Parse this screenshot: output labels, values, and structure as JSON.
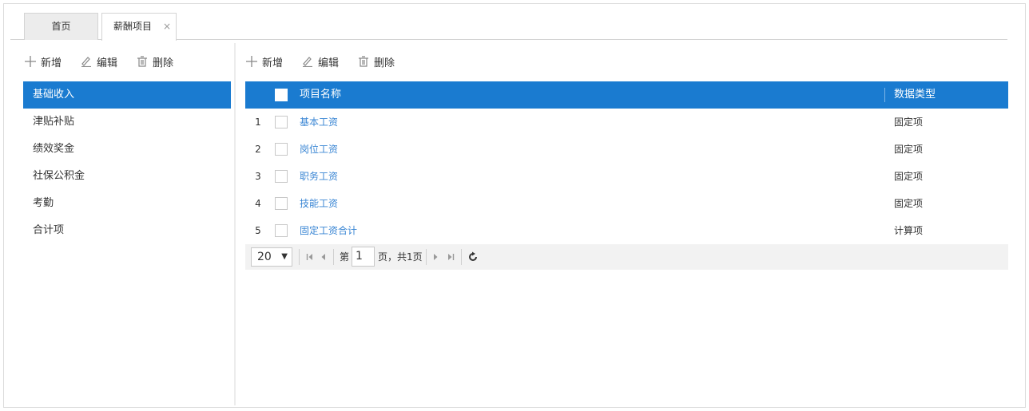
{
  "tabs": {
    "home": "首页",
    "active": "薪酬项目",
    "close_glyph": "×"
  },
  "left_toolbar": {
    "add": "新增",
    "edit": "编辑",
    "delete": "删除"
  },
  "right_toolbar": {
    "add": "新增",
    "edit": "编辑",
    "delete": "删除"
  },
  "categories": [
    "基础收入",
    "津贴补贴",
    "绩效奖金",
    "社保公积金",
    "考勤",
    "合计项"
  ],
  "selected_category": "基础收入",
  "grid": {
    "columns": {
      "name": "项目名称",
      "type": "数据类型"
    },
    "rows": [
      {
        "num": "1",
        "name": "基本工资",
        "type": "固定项"
      },
      {
        "num": "2",
        "name": "岗位工资",
        "type": "固定项"
      },
      {
        "num": "3",
        "name": "职务工资",
        "type": "固定项"
      },
      {
        "num": "4",
        "name": "技能工资",
        "type": "固定项"
      },
      {
        "num": "5",
        "name": "固定工资合计",
        "type": "计算项"
      }
    ]
  },
  "pager": {
    "page_size": "20",
    "prefix": "第",
    "page": "1",
    "suffix": "页，共1页"
  },
  "colors": {
    "accent": "#1a7bd0",
    "link": "#3a86d4"
  }
}
